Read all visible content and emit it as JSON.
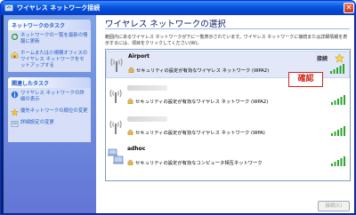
{
  "window": {
    "title": "ワイヤレス ネットワーク接続",
    "close_label": "✕"
  },
  "sidebar": {
    "network_tasks": {
      "header": "ネットワークのタスク",
      "items": [
        {
          "label": "ネットワークの一覧を最新の情報に更新",
          "icon": "refresh-icon"
        },
        {
          "label": "ホームまたは小規模オフィスのワイヤレス ネットワークをセットアップする",
          "icon": "setup-wizard-icon"
        }
      ]
    },
    "related_tasks": {
      "header": "関連したタスク",
      "items": [
        {
          "label": "ワイヤレス ネットワークの詳細の表示",
          "icon": "info-icon"
        },
        {
          "label": "優先ネットワークの順位の変更",
          "icon": "star-icon"
        },
        {
          "label": "詳細設定の変更",
          "icon": "settings-icon"
        }
      ]
    }
  },
  "main": {
    "heading": "ワイヤレス ネットワークの選択",
    "description": "範囲内にあるワイヤレス ネットワークが下に一覧表示されています。ワイヤレス ネットワークに接続または詳細情報を表示するには、項目をクリックしてください(W)。",
    "networks": [
      {
        "name": "Airport",
        "security": "セキュリティの設定が有効なワイヤレス ネットワーク (WPA2)",
        "status": "接続",
        "signal": 5,
        "selected": true
      },
      {
        "name": "",
        "security": "セキュリティの設定が有効なワイヤレス ネットワーク (WPA2)",
        "signal": 5
      },
      {
        "name": "",
        "security": "セキュリティの設定が有効なワイヤレス ネットワーク (WPA)",
        "signal": 5
      },
      {
        "name": "adhoc",
        "security": "セキュリティの設定が有効なコンピュータ相互ネットワーク",
        "signal": 5,
        "type": "ad-hoc"
      }
    ],
    "annotation": "確認",
    "connect_button": "接続(C)"
  },
  "colors": {
    "title_bar": "#0a58e0",
    "link": "#215dc6",
    "annotation": "#d0261d",
    "signal": "#2fa52f"
  }
}
